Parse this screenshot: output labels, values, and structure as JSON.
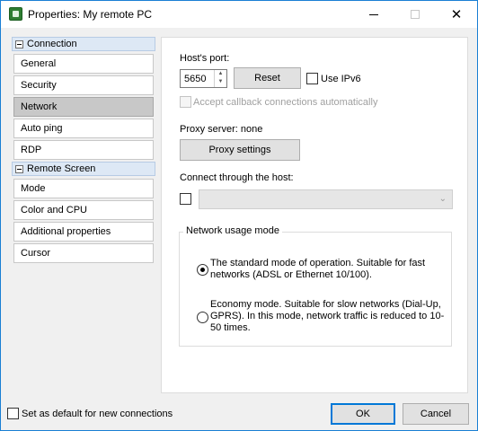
{
  "window": {
    "title": "Properties: My remote PC",
    "icon": "app-icon",
    "controls": [
      "minimize-icon",
      "maximize-icon",
      "close-icon"
    ]
  },
  "nav": {
    "groups": [
      {
        "label": "Connection",
        "expanded": true,
        "items": [
          "General",
          "Security",
          "Network",
          "Auto ping",
          "RDP"
        ]
      },
      {
        "label": "Remote Screen",
        "expanded": true,
        "items": [
          "Mode",
          "Color and CPU",
          "Additional properties",
          "Cursor"
        ]
      }
    ],
    "selected": "Network"
  },
  "network": {
    "port_label": "Host's port:",
    "port_value": "5650",
    "reset_label": "Reset",
    "ipv6_label": "Use IPv6",
    "ipv6_checked": false,
    "callback_label": "Accept callback connections automatically",
    "callback_checked": false,
    "callback_enabled": false,
    "proxy_status": "Proxy server: none",
    "proxy_button": "Proxy settings",
    "through_host_label": "Connect through the host:",
    "through_host_checked": false,
    "through_host_value": "",
    "usage_group_label": "Network usage mode",
    "modes": [
      {
        "label": "The standard mode of operation. Suitable for fast networks (ADSL or Ethernet 10/100).",
        "checked": true
      },
      {
        "label": "Economy mode. Suitable for slow networks (Dial-Up, GPRS). In this mode, network traffic is reduced to 10-50 times.",
        "checked": false
      }
    ]
  },
  "footer": {
    "default_label": "Set as default for new connections",
    "default_checked": false,
    "ok_label": "OK",
    "cancel_label": "Cancel"
  },
  "colors": {
    "accent": "#0078d7",
    "nav_selected": "#c8c8c8",
    "group_header": "#dde8f5"
  }
}
